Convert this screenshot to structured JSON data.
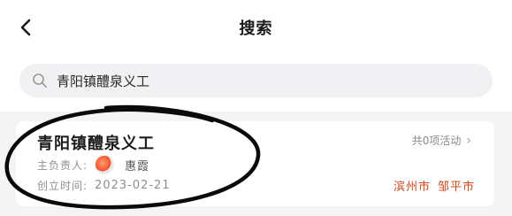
{
  "header": {
    "title": "搜索",
    "back_icon": "chevron-left-icon"
  },
  "search": {
    "value": "青阳镇醴泉义工",
    "icon": "search-icon"
  },
  "result_card": {
    "org_name": "青阳镇醴泉义工",
    "activity_count": "共0项活动",
    "leader_label": "主负责人:",
    "leader_name": "惠霞",
    "founded_label": "创立时间:",
    "founded_date": "2023-02-21",
    "city": "滨州市",
    "district": "邹平市"
  },
  "colors": {
    "accent": "#c8491d",
    "background": "#f4f4f5",
    "card": "#ffffff"
  }
}
